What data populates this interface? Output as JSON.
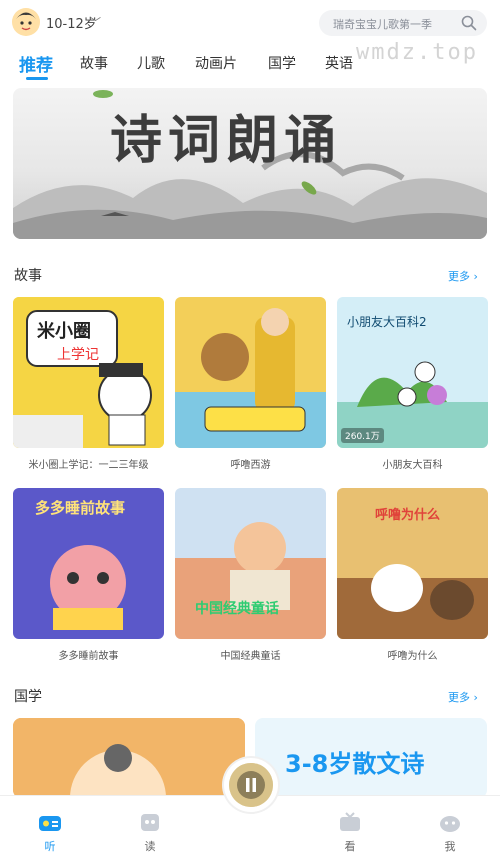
{
  "header": {
    "age_label": "10-12岁",
    "search_placeholder": "瑞奇宝宝儿歌第一季"
  },
  "tabs": [
    "推荐",
    "故事",
    "儿歌",
    "动画片",
    "国学",
    "英语"
  ],
  "watermark": "wmdz.top",
  "banner": {
    "title": "诗词朗诵"
  },
  "story_section": {
    "title": "故事",
    "more": "更多 ›",
    "cards": [
      {
        "caption": "米小圈上学记：一二三年级",
        "badge": ""
      },
      {
        "caption": "呼噜西游",
        "badge": ""
      },
      {
        "caption": "小朋友大百科",
        "badge": "260.1万",
        "title": "小朋友大百科2"
      },
      {
        "caption": "多多睡前故事",
        "badge": "",
        "title": "多多睡前故事"
      },
      {
        "caption": "中国经典童话",
        "badge": "",
        "title": "中国经典童话"
      },
      {
        "caption": "呼噜为什么",
        "badge": "",
        "title": "呼噜为什么"
      }
    ]
  },
  "guoxue_section": {
    "title": "国学",
    "more": "更多 ›",
    "card2_title": "3-8岁散文诗"
  },
  "nav": {
    "items": [
      "听",
      "读",
      "看",
      "我"
    ],
    "active": "听"
  },
  "colors": {
    "accent": "#1a97f0"
  }
}
